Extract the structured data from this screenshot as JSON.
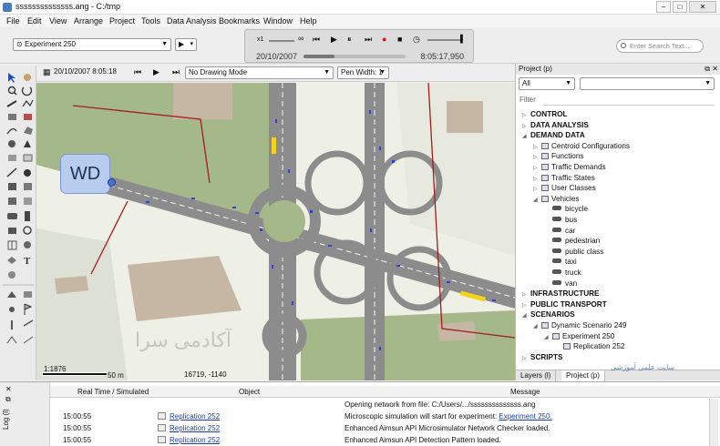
{
  "window": {
    "title": "ssssssssssssss.ang - C:/tmp",
    "minimize_glyph": "–",
    "maximize_glyph": "□",
    "close_glyph": "✕"
  },
  "menu": [
    "File",
    "Edit",
    "View",
    "Arrange",
    "Project",
    "Tools",
    "Data Analysis",
    "Bookmarks",
    "Window",
    "Help"
  ],
  "toolbar": {
    "experiment_selector": "Experiment 250",
    "speed_label": "x1",
    "speed_max": "∞",
    "sim_date": "20/10/2007",
    "sim_time": "8:05:17,950",
    "sim_progress": 0.3,
    "search_placeholder": "Enter Search Text..."
  },
  "view_toolbar": {
    "datetime": "20/10/2007 8:05:18",
    "drawing_mode": "No Drawing Mode",
    "pen_width": "Pen Width: 1"
  },
  "map": {
    "tag_label": "WD",
    "scale_ratio": "1:1876",
    "scale_length": "50 m",
    "coordinates": "16719, -1140",
    "watermark": "آکادمی سرا",
    "colors": {
      "grass": "#a5b889",
      "building": "#c6b6a4",
      "road": "#8c8c8c",
      "lane": "#f5f5f5",
      "vehicle": "#2f3fe0",
      "boundary": "#a31d1d",
      "highlight": "#f5d31d"
    }
  },
  "project": {
    "title": "Project (p)",
    "filter_all": "All",
    "filter_label": "Filter",
    "tree": [
      {
        "label": "CONTROL",
        "bold": true,
        "level": 0,
        "exp": "▷"
      },
      {
        "label": "DATA ANALYSIS",
        "bold": true,
        "level": 0,
        "exp": "▷"
      },
      {
        "label": "DEMAND DATA",
        "bold": true,
        "level": 0,
        "exp": "◢"
      },
      {
        "label": "Centroid Configurations",
        "bold": false,
        "level": 1,
        "exp": "▷",
        "icon": "folder"
      },
      {
        "label": "Functions",
        "bold": false,
        "level": 1,
        "exp": "▷",
        "icon": "folder"
      },
      {
        "label": "Traffic Demands",
        "bold": false,
        "level": 1,
        "exp": "▷",
        "icon": "folder"
      },
      {
        "label": "Traffic States",
        "bold": false,
        "level": 1,
        "exp": "▷",
        "icon": "folder"
      },
      {
        "label": "User Classes",
        "bold": false,
        "level": 1,
        "exp": "▷",
        "icon": "folder"
      },
      {
        "label": "Vehicles",
        "bold": false,
        "level": 1,
        "exp": "◢",
        "icon": "folder"
      },
      {
        "label": "bicycle",
        "bold": false,
        "level": 2,
        "icon": "vehicle"
      },
      {
        "label": "bus",
        "bold": false,
        "level": 2,
        "icon": "vehicle"
      },
      {
        "label": "car",
        "bold": false,
        "level": 2,
        "icon": "vehicle"
      },
      {
        "label": "pedestrian",
        "bold": false,
        "level": 2,
        "icon": "vehicle"
      },
      {
        "label": "public class",
        "bold": false,
        "level": 2,
        "icon": "vehicle"
      },
      {
        "label": "taxi",
        "bold": false,
        "level": 2,
        "icon": "vehicle"
      },
      {
        "label": "truck",
        "bold": false,
        "level": 2,
        "icon": "vehicle"
      },
      {
        "label": "van",
        "bold": false,
        "level": 2,
        "icon": "vehicle"
      },
      {
        "label": "INFRASTRUCTURE",
        "bold": true,
        "level": 0,
        "exp": "▷"
      },
      {
        "label": "PUBLIC TRANSPORT",
        "bold": true,
        "level": 0,
        "exp": "▷"
      },
      {
        "label": "SCENARIOS",
        "bold": true,
        "level": 0,
        "exp": "◢"
      },
      {
        "label": "Dynamic Scenario 249",
        "bold": false,
        "level": 1,
        "exp": "◢",
        "icon": "scenario"
      },
      {
        "label": "Experiment 250",
        "bold": false,
        "level": 2,
        "exp": "◢",
        "icon": "experiment"
      },
      {
        "label": "Replication 252",
        "bold": false,
        "level": 3,
        "icon": "replication"
      },
      {
        "label": "SCRIPTS",
        "bold": true,
        "level": 0,
        "exp": "▷"
      }
    ],
    "tabs": [
      "Layers (l)",
      "Project (p)"
    ]
  },
  "log": {
    "side_label": "Log (l)",
    "columns": [
      "Real Time / Simulated",
      "Object",
      "Message"
    ],
    "rows": [
      {
        "time": "",
        "object": "",
        "message": "Opening network from file: C:/Users/.../ssssssssssssss.ang"
      },
      {
        "time": "15:00:55",
        "object": "Replication 252",
        "message": "Microscopic simulation will start for experiment:",
        "message_link": "Experiment 250."
      },
      {
        "time": "15:00:55",
        "object": "Replication 252",
        "message": "Enhanced Aimsun API Microsimulator Network Checker loaded."
      },
      {
        "time": "15:00:55",
        "object": "Replication 252",
        "message": "Enhanced Aimsun API Detection Pattern loaded."
      }
    ]
  },
  "overlay_watermark": "سایت علمی آموزشی"
}
